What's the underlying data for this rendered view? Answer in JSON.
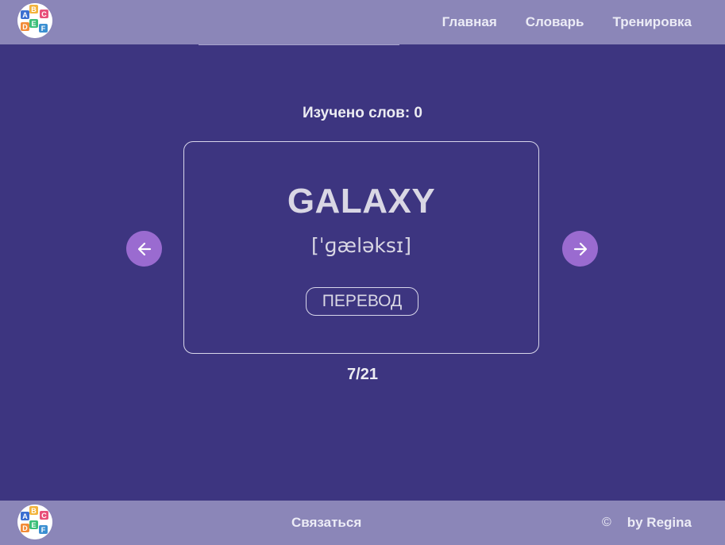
{
  "header": {
    "logo_icon": "abc-blocks-logo",
    "nav": [
      {
        "label": "Главная"
      },
      {
        "label": "Словарь"
      },
      {
        "label": "Тренировка"
      }
    ]
  },
  "main": {
    "learned_counter": "Изучено слов: 0",
    "card": {
      "word": "GALAXY",
      "transcription": "[ˈɡæləksɪ]",
      "translate_button": "ПЕРЕВОД"
    },
    "prev_icon": "arrow-left-icon",
    "next_icon": "arrow-right-icon",
    "progress": "7/21"
  },
  "footer": {
    "contact": "Связаться",
    "copyright_symbol": "©",
    "author": "by Regina"
  },
  "colors": {
    "background": "#3d3580",
    "header_footer": "#8b86b8",
    "arrow_button": "#9a6bd0",
    "card_text": "#d9d7e4"
  }
}
